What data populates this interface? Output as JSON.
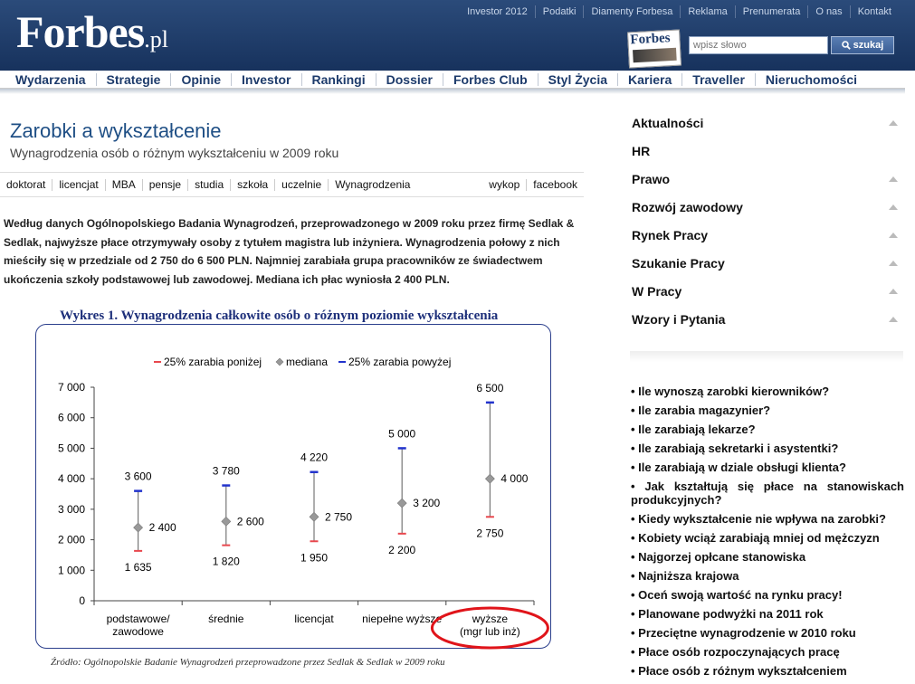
{
  "header": {
    "logo": "Forbes",
    "logo_suffix": ".pl",
    "top_links": [
      "Investor 2012",
      "Podatki",
      "Diamenty Forbesa",
      "Reklama",
      "Prenumerata",
      "O nas",
      "Kontakt"
    ],
    "magazine_title": "Forbes",
    "search_placeholder": "wpisz słowo",
    "search_button": "szukaj"
  },
  "main_nav": [
    "Wydarzenia",
    "Strategie",
    "Opinie",
    "Investor",
    "Rankingi",
    "Dossier",
    "Forbes Club",
    "Styl Życia",
    "Kariera",
    "Traveller",
    "Nieruchomości"
  ],
  "article": {
    "title": "Zarobki a wykształcenie",
    "subtitle": "Wynagrodzenia osób o różnym wykształceniu w 2009 roku",
    "tags": [
      "doktorat",
      "licencjat",
      "MBA",
      "pensje",
      "studia",
      "szkoła",
      "uczelnie",
      "Wynagrodzenia"
    ],
    "share": [
      "wykop",
      "facebook"
    ],
    "body": "Według danych Ogólnopolskiego Badania Wynagrodzeń, przeprowadzonego w 2009 roku przez firmę Sedlak & Sedlak,  najwyższe płace otrzymywały osoby z tytułem magistra lub inżyniera. Wynagrodzenia połowy z nich mieściły się w przedziale od 2 750 do 6 500 PLN. Najmniej zarabiała grupa pracowników ze świadectwem ukończenia szkoły podstawowej lub zawodowej. Mediana ich płac wyniosła 2 400 PLN.",
    "chart_source": "Źródło: Ogólnopolskie Badanie Wynagrodzeń przeprowadzone przez Sedlak & Sedlak w 2009 roku"
  },
  "chart_data": {
    "type": "range",
    "title": "Wykres 1. Wynagrodzenia całkowite osób o różnym poziomie wykształcenia",
    "legend": [
      "25% zarabia poniżej",
      "mediana",
      "25% zarabia powyżej"
    ],
    "legend_position": "top",
    "categories": [
      "podstawowe/ zawodowe",
      "średnie",
      "licencjat",
      "niepełne wyższe",
      "wyższe (mgr lub inż)"
    ],
    "category_lines": [
      [
        "podstawowe/",
        "zawodowe"
      ],
      [
        "średnie"
      ],
      [
        "licencjat"
      ],
      [
        "niepełne wyższe"
      ],
      [
        "wyższe",
        "(mgr lub inż)"
      ]
    ],
    "series": [
      {
        "name": "25% zarabia poniżej",
        "values": [
          1635,
          1820,
          1950,
          2200,
          2750
        ],
        "labels": [
          "1 635",
          "1 820",
          "1 950",
          "2 200",
          "2 750"
        ]
      },
      {
        "name": "mediana",
        "values": [
          2400,
          2600,
          2750,
          3200,
          4000
        ],
        "labels": [
          "2 400",
          "2 600",
          "2 750",
          "3 200",
          "4 000"
        ]
      },
      {
        "name": "25% zarabia powyżej",
        "values": [
          3600,
          3780,
          4220,
          5000,
          6500
        ],
        "labels": [
          "3 600",
          "3 780",
          "4 220",
          "5 000",
          "6 500"
        ]
      }
    ],
    "yticks": [
      "0",
      "1 000",
      "2 000",
      "3 000",
      "4 000",
      "5 000",
      "6 000",
      "7 000"
    ],
    "ylim": [
      0,
      7000
    ],
    "highlighted_category": "wyższe (mgr lub inż)",
    "colors": {
      "low": "#e8474d",
      "median": "#999999",
      "high": "#2233cc",
      "range": "#777777",
      "highlight": "#e0141a"
    }
  },
  "sidebar": {
    "categories": [
      "Aktualności",
      "HR",
      "Prawo",
      "Rozwój zawodowy",
      "Rynek Pracy",
      "Szukanie Pracy",
      "W Pracy",
      "Wzory i Pytania"
    ],
    "category_has_arrow": [
      true,
      false,
      true,
      true,
      true,
      true,
      true,
      true
    ],
    "related": [
      "• Ile wynoszą zarobki kierowników?",
      "• Ile zarabia magazynier?",
      "• Ile zarabiają lekarze?",
      "• Ile zarabiają sekretarki i asystentki?",
      "• Ile zarabiają w dziale obsługi klienta?",
      "• Jak kształtują się płace na stanowiskach produkcyjnych?",
      "• Kiedy wykształcenie nie wpływa na zarobki?",
      "• Kobiety wciąż zarabiają mniej od mężczyzn",
      "• Najgorzej opłcane stanowiska",
      "• Najniższa krajowa",
      "• Oceń swoją wartość na rynku pracy!",
      "• Planowane podwyżki na 2011 rok",
      "• Przeciętne wynagrodzenie w 2010 roku",
      "• Płace osób rozpoczynających pracę",
      "• Płace osób z różnym wykształceniem"
    ]
  }
}
